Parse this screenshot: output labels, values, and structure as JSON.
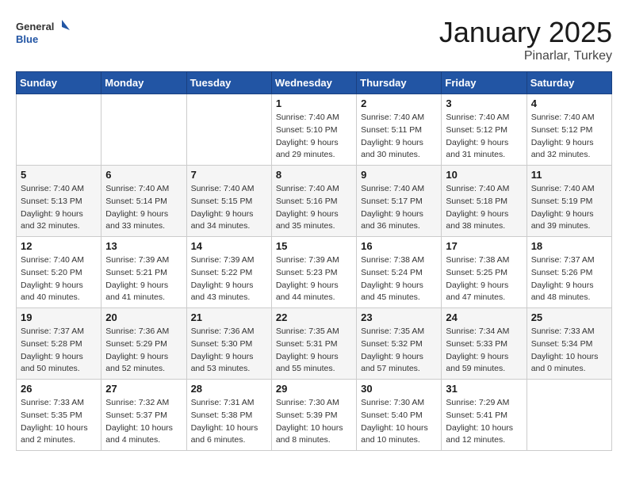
{
  "logo": {
    "line1": "General",
    "line2": "Blue"
  },
  "title": "January 2025",
  "location": "Pinarlar, Turkey",
  "days_of_week": [
    "Sunday",
    "Monday",
    "Tuesday",
    "Wednesday",
    "Thursday",
    "Friday",
    "Saturday"
  ],
  "weeks": [
    [
      {
        "day": "",
        "info": ""
      },
      {
        "day": "",
        "info": ""
      },
      {
        "day": "",
        "info": ""
      },
      {
        "day": "1",
        "info": "Sunrise: 7:40 AM\nSunset: 5:10 PM\nDaylight: 9 hours\nand 29 minutes."
      },
      {
        "day": "2",
        "info": "Sunrise: 7:40 AM\nSunset: 5:11 PM\nDaylight: 9 hours\nand 30 minutes."
      },
      {
        "day": "3",
        "info": "Sunrise: 7:40 AM\nSunset: 5:12 PM\nDaylight: 9 hours\nand 31 minutes."
      },
      {
        "day": "4",
        "info": "Sunrise: 7:40 AM\nSunset: 5:12 PM\nDaylight: 9 hours\nand 32 minutes."
      }
    ],
    [
      {
        "day": "5",
        "info": "Sunrise: 7:40 AM\nSunset: 5:13 PM\nDaylight: 9 hours\nand 32 minutes."
      },
      {
        "day": "6",
        "info": "Sunrise: 7:40 AM\nSunset: 5:14 PM\nDaylight: 9 hours\nand 33 minutes."
      },
      {
        "day": "7",
        "info": "Sunrise: 7:40 AM\nSunset: 5:15 PM\nDaylight: 9 hours\nand 34 minutes."
      },
      {
        "day": "8",
        "info": "Sunrise: 7:40 AM\nSunset: 5:16 PM\nDaylight: 9 hours\nand 35 minutes."
      },
      {
        "day": "9",
        "info": "Sunrise: 7:40 AM\nSunset: 5:17 PM\nDaylight: 9 hours\nand 36 minutes."
      },
      {
        "day": "10",
        "info": "Sunrise: 7:40 AM\nSunset: 5:18 PM\nDaylight: 9 hours\nand 38 minutes."
      },
      {
        "day": "11",
        "info": "Sunrise: 7:40 AM\nSunset: 5:19 PM\nDaylight: 9 hours\nand 39 minutes."
      }
    ],
    [
      {
        "day": "12",
        "info": "Sunrise: 7:40 AM\nSunset: 5:20 PM\nDaylight: 9 hours\nand 40 minutes."
      },
      {
        "day": "13",
        "info": "Sunrise: 7:39 AM\nSunset: 5:21 PM\nDaylight: 9 hours\nand 41 minutes."
      },
      {
        "day": "14",
        "info": "Sunrise: 7:39 AM\nSunset: 5:22 PM\nDaylight: 9 hours\nand 43 minutes."
      },
      {
        "day": "15",
        "info": "Sunrise: 7:39 AM\nSunset: 5:23 PM\nDaylight: 9 hours\nand 44 minutes."
      },
      {
        "day": "16",
        "info": "Sunrise: 7:38 AM\nSunset: 5:24 PM\nDaylight: 9 hours\nand 45 minutes."
      },
      {
        "day": "17",
        "info": "Sunrise: 7:38 AM\nSunset: 5:25 PM\nDaylight: 9 hours\nand 47 minutes."
      },
      {
        "day": "18",
        "info": "Sunrise: 7:37 AM\nSunset: 5:26 PM\nDaylight: 9 hours\nand 48 minutes."
      }
    ],
    [
      {
        "day": "19",
        "info": "Sunrise: 7:37 AM\nSunset: 5:28 PM\nDaylight: 9 hours\nand 50 minutes."
      },
      {
        "day": "20",
        "info": "Sunrise: 7:36 AM\nSunset: 5:29 PM\nDaylight: 9 hours\nand 52 minutes."
      },
      {
        "day": "21",
        "info": "Sunrise: 7:36 AM\nSunset: 5:30 PM\nDaylight: 9 hours\nand 53 minutes."
      },
      {
        "day": "22",
        "info": "Sunrise: 7:35 AM\nSunset: 5:31 PM\nDaylight: 9 hours\nand 55 minutes."
      },
      {
        "day": "23",
        "info": "Sunrise: 7:35 AM\nSunset: 5:32 PM\nDaylight: 9 hours\nand 57 minutes."
      },
      {
        "day": "24",
        "info": "Sunrise: 7:34 AM\nSunset: 5:33 PM\nDaylight: 9 hours\nand 59 minutes."
      },
      {
        "day": "25",
        "info": "Sunrise: 7:33 AM\nSunset: 5:34 PM\nDaylight: 10 hours\nand 0 minutes."
      }
    ],
    [
      {
        "day": "26",
        "info": "Sunrise: 7:33 AM\nSunset: 5:35 PM\nDaylight: 10 hours\nand 2 minutes."
      },
      {
        "day": "27",
        "info": "Sunrise: 7:32 AM\nSunset: 5:37 PM\nDaylight: 10 hours\nand 4 minutes."
      },
      {
        "day": "28",
        "info": "Sunrise: 7:31 AM\nSunset: 5:38 PM\nDaylight: 10 hours\nand 6 minutes."
      },
      {
        "day": "29",
        "info": "Sunrise: 7:30 AM\nSunset: 5:39 PM\nDaylight: 10 hours\nand 8 minutes."
      },
      {
        "day": "30",
        "info": "Sunrise: 7:30 AM\nSunset: 5:40 PM\nDaylight: 10 hours\nand 10 minutes."
      },
      {
        "day": "31",
        "info": "Sunrise: 7:29 AM\nSunset: 5:41 PM\nDaylight: 10 hours\nand 12 minutes."
      },
      {
        "day": "",
        "info": ""
      }
    ]
  ]
}
